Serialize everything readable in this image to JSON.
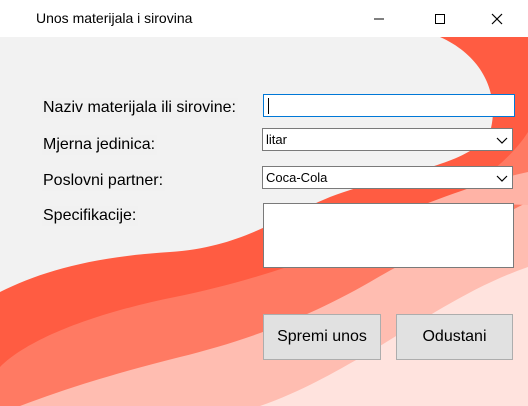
{
  "window": {
    "title": "Unos materijala i sirovina"
  },
  "form": {
    "name_label": "Naziv materijala ili sirovine:",
    "name_value": "",
    "unit_label": "Mjerna jedinica:",
    "unit_value": "litar",
    "partner_label": "Poslovni partner:",
    "partner_value": "Coca-Cola",
    "spec_label": "Specifikacije:",
    "spec_value": ""
  },
  "buttons": {
    "save_label": "Spremi unos",
    "cancel_label": "Odustani"
  },
  "colors": {
    "wave_dark": "#ff5a3c",
    "wave_mid": "#ff8a75",
    "wave_light": "#ffc9bf",
    "background": "#f2f2f2"
  }
}
